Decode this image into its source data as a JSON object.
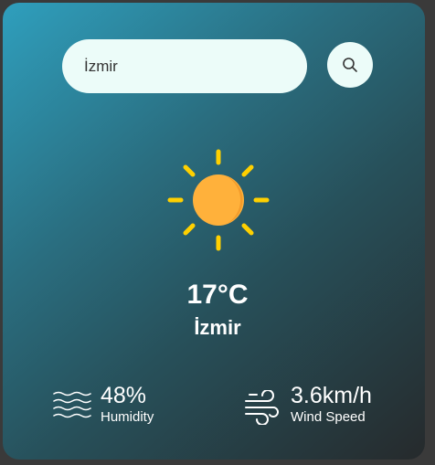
{
  "search": {
    "value": "İzmir",
    "icon": "search-icon"
  },
  "weather": {
    "icon": "sun-icon",
    "temperature": "17°C",
    "city": "İzmir"
  },
  "details": {
    "humidity": {
      "value": "48%",
      "label": "Humidity",
      "icon": "waves-icon"
    },
    "wind": {
      "value": "3.6km/h",
      "label": "Wind Speed",
      "icon": "wind-icon"
    }
  },
  "colors": {
    "sun": "#ffb13b",
    "rays": "#ffd000",
    "field_bg": "#ecfcf9"
  }
}
